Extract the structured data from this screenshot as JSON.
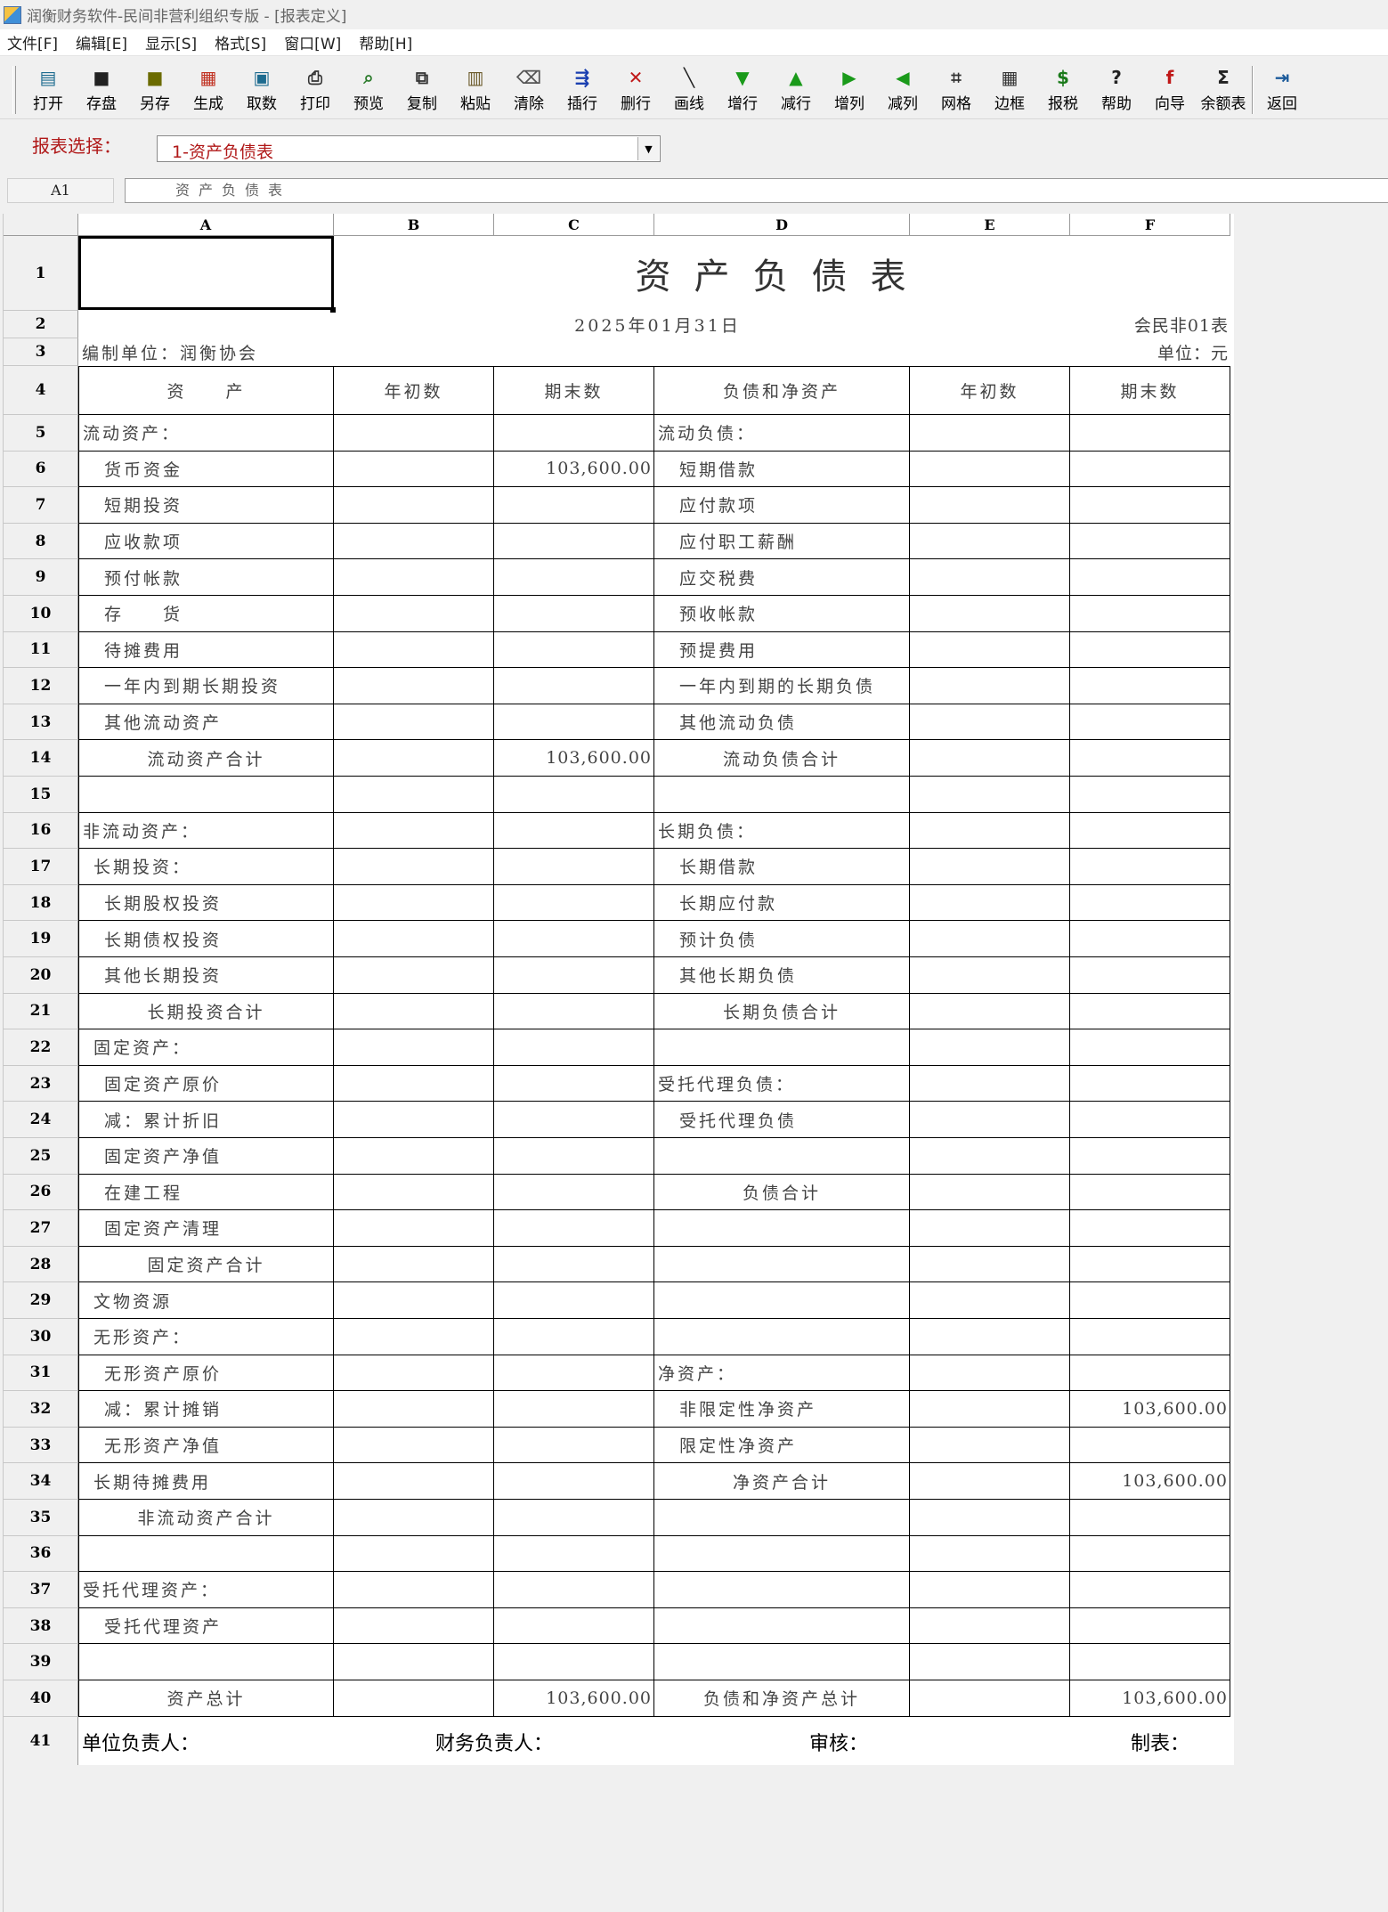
{
  "window": {
    "title": "润衡财务软件-民间非营利组织专版 - [报表定义]"
  },
  "menu": [
    "文件[F]",
    "编辑[E]",
    "显示[S]",
    "格式[S]",
    "窗口[W]",
    "帮助[H]"
  ],
  "toolbar": [
    {
      "label": "打开",
      "icon": "open-icon",
      "glyph": "▤",
      "color": "#1d6b8f"
    },
    {
      "label": "存盘",
      "icon": "save-icon",
      "glyph": "■",
      "color": "#222222"
    },
    {
      "label": "另存",
      "icon": "save-as-icon",
      "glyph": "■",
      "color": "#6b6b00"
    },
    {
      "label": "生成",
      "icon": "generate-icon",
      "glyph": "▦",
      "color": "#c03020"
    },
    {
      "label": "取数",
      "icon": "fetch-data-icon",
      "glyph": "▣",
      "color": "#1d6b8f"
    },
    {
      "label": "打印",
      "icon": "print-icon",
      "glyph": "⎙",
      "color": "#333333"
    },
    {
      "label": "预览",
      "icon": "preview-icon",
      "glyph": "⌕",
      "color": "#2a7a2a"
    },
    {
      "label": "复制",
      "icon": "copy-icon",
      "glyph": "⧉",
      "color": "#333333"
    },
    {
      "label": "粘贴",
      "icon": "paste-icon",
      "glyph": "▥",
      "color": "#6b5a2a"
    },
    {
      "label": "清除",
      "icon": "clear-icon",
      "glyph": "⌫",
      "color": "#555555"
    },
    {
      "label": "插行",
      "icon": "insert-row-icon",
      "glyph": "⇶",
      "color": "#1a3fb0"
    },
    {
      "label": "删行",
      "icon": "delete-row-icon",
      "glyph": "✕",
      "color": "#c01818"
    },
    {
      "label": "画线",
      "icon": "draw-line-icon",
      "glyph": "╲",
      "color": "#222222"
    },
    {
      "label": "增行",
      "icon": "add-row-icon",
      "glyph": "▼",
      "color": "#1a9a1a"
    },
    {
      "label": "减行",
      "icon": "remove-row-icon",
      "glyph": "▲",
      "color": "#1a9a1a"
    },
    {
      "label": "增列",
      "icon": "add-column-icon",
      "glyph": "▶",
      "color": "#1a9a1a"
    },
    {
      "label": "减列",
      "icon": "remove-column-icon",
      "glyph": "◀",
      "color": "#1a9a1a"
    },
    {
      "label": "网格",
      "icon": "grid-icon",
      "glyph": "⌗",
      "color": "#333333"
    },
    {
      "label": "边框",
      "icon": "border-icon",
      "glyph": "▦",
      "color": "#333333"
    },
    {
      "label": "报税",
      "icon": "tax-icon",
      "glyph": "$",
      "color": "#1a7a1a"
    },
    {
      "label": "帮助",
      "icon": "help-icon",
      "glyph": "?",
      "color": "#222222"
    },
    {
      "label": "向导",
      "icon": "wizard-icon",
      "glyph": "f",
      "color": "#c01818"
    },
    {
      "label": "余额表",
      "icon": "balance-table-icon",
      "glyph": "Σ",
      "color": "#222222"
    },
    {
      "label": "返回",
      "icon": "return-icon",
      "glyph": "⇥",
      "color": "#1a5a9a"
    }
  ],
  "report_select": {
    "label": "报表选择：",
    "value": "1-资产负债表"
  },
  "formula_bar": {
    "cell_ref": "A1",
    "content": "资产负债表"
  },
  "columns": [
    "A",
    "B",
    "C",
    "D",
    "E",
    "F"
  ],
  "sheet": {
    "title": "资产负债表",
    "date": "2025年01月31日",
    "form_no": "会民非01表",
    "org": "编制单位：润衡协会",
    "unit": "单位：元",
    "headers": [
      "资　　产",
      "年初数",
      "期末数",
      "负债和净资产",
      "年初数",
      "期末数"
    ],
    "rows": [
      {
        "n": "5",
        "a": "流动资产：",
        "ai": 0,
        "b": "",
        "c": "",
        "d": "流动负债：",
        "di": 0,
        "e": "",
        "f": ""
      },
      {
        "n": "6",
        "a": "货币资金",
        "ai": 2,
        "b": "",
        "c": "103,600.00",
        "d": "短期借款",
        "di": 2,
        "e": "",
        "f": ""
      },
      {
        "n": "7",
        "a": "短期投资",
        "ai": 2,
        "b": "",
        "c": "",
        "d": "应付款项",
        "di": 2,
        "e": "",
        "f": ""
      },
      {
        "n": "8",
        "a": "应收款项",
        "ai": 2,
        "b": "",
        "c": "",
        "d": "应付职工薪酬",
        "di": 2,
        "e": "",
        "f": ""
      },
      {
        "n": "9",
        "a": "预付帐款",
        "ai": 2,
        "b": "",
        "c": "",
        "d": "应交税费",
        "di": 2,
        "e": "",
        "f": ""
      },
      {
        "n": "10",
        "a": "存　　货",
        "ai": 2,
        "b": "",
        "c": "",
        "d": "预收帐款",
        "di": 2,
        "e": "",
        "f": ""
      },
      {
        "n": "11",
        "a": "待摊费用",
        "ai": 2,
        "b": "",
        "c": "",
        "d": "预提费用",
        "di": 2,
        "e": "",
        "f": ""
      },
      {
        "n": "12",
        "a": "一年内到期长期投资",
        "ai": 2,
        "b": "",
        "c": "",
        "d": "一年内到期的长期负债",
        "di": 2,
        "e": "",
        "f": ""
      },
      {
        "n": "13",
        "a": "其他流动资产",
        "ai": 2,
        "b": "",
        "c": "",
        "d": "其他流动负债",
        "di": 2,
        "e": "",
        "f": ""
      },
      {
        "n": "14",
        "a": "流动资产合计",
        "ai": -1,
        "b": "",
        "c": "103,600.00",
        "d": "流动负债合计",
        "di": -1,
        "e": "",
        "f": ""
      },
      {
        "n": "15",
        "a": "",
        "ai": 0,
        "b": "",
        "c": "",
        "d": "",
        "di": 0,
        "e": "",
        "f": ""
      },
      {
        "n": "16",
        "a": "非流动资产：",
        "ai": 0,
        "b": "",
        "c": "",
        "d": "长期负债：",
        "di": 0,
        "e": "",
        "f": ""
      },
      {
        "n": "17",
        "a": "长期投资：",
        "ai": 1,
        "b": "",
        "c": "",
        "d": "长期借款",
        "di": 2,
        "e": "",
        "f": ""
      },
      {
        "n": "18",
        "a": "长期股权投资",
        "ai": 2,
        "b": "",
        "c": "",
        "d": "长期应付款",
        "di": 2,
        "e": "",
        "f": ""
      },
      {
        "n": "19",
        "a": "长期债权投资",
        "ai": 2,
        "b": "",
        "c": "",
        "d": "预计负债",
        "di": 2,
        "e": "",
        "f": ""
      },
      {
        "n": "20",
        "a": "其他长期投资",
        "ai": 2,
        "b": "",
        "c": "",
        "d": "其他长期负债",
        "di": 2,
        "e": "",
        "f": ""
      },
      {
        "n": "21",
        "a": "长期投资合计",
        "ai": -1,
        "b": "",
        "c": "",
        "d": "长期负债合计",
        "di": -1,
        "e": "",
        "f": ""
      },
      {
        "n": "22",
        "a": "固定资产：",
        "ai": 1,
        "b": "",
        "c": "",
        "d": "",
        "di": 0,
        "e": "",
        "f": ""
      },
      {
        "n": "23",
        "a": "固定资产原价",
        "ai": 2,
        "b": "",
        "c": "",
        "d": "受托代理负债：",
        "di": 0,
        "e": "",
        "f": ""
      },
      {
        "n": "24",
        "a": "减：累计折旧",
        "ai": 2,
        "b": "",
        "c": "",
        "d": "受托代理负债",
        "di": 2,
        "e": "",
        "f": ""
      },
      {
        "n": "25",
        "a": "固定资产净值",
        "ai": 2,
        "b": "",
        "c": "",
        "d": "",
        "di": 0,
        "e": "",
        "f": ""
      },
      {
        "n": "26",
        "a": "在建工程",
        "ai": 2,
        "b": "",
        "c": "",
        "d": "负债合计",
        "di": -1,
        "e": "",
        "f": ""
      },
      {
        "n": "27",
        "a": "固定资产清理",
        "ai": 2,
        "b": "",
        "c": "",
        "d": "",
        "di": 0,
        "e": "",
        "f": ""
      },
      {
        "n": "28",
        "a": "固定资产合计",
        "ai": -1,
        "b": "",
        "c": "",
        "d": "",
        "di": 0,
        "e": "",
        "f": ""
      },
      {
        "n": "29",
        "a": "文物资源",
        "ai": 1,
        "b": "",
        "c": "",
        "d": "",
        "di": 0,
        "e": "",
        "f": ""
      },
      {
        "n": "30",
        "a": "无形资产：",
        "ai": 1,
        "b": "",
        "c": "",
        "d": "",
        "di": 0,
        "e": "",
        "f": ""
      },
      {
        "n": "31",
        "a": "无形资产原价",
        "ai": 2,
        "b": "",
        "c": "",
        "d": "净资产：",
        "di": 0,
        "e": "",
        "f": ""
      },
      {
        "n": "32",
        "a": "减：累计摊销",
        "ai": 2,
        "b": "",
        "c": "",
        "d": "非限定性净资产",
        "di": 2,
        "e": "",
        "f": "103,600.00"
      },
      {
        "n": "33",
        "a": "无形资产净值",
        "ai": 2,
        "b": "",
        "c": "",
        "d": "限定性净资产",
        "di": 2,
        "e": "",
        "f": ""
      },
      {
        "n": "34",
        "a": "长期待摊费用",
        "ai": 1,
        "b": "",
        "c": "",
        "d": "净资产合计",
        "di": -1,
        "e": "",
        "f": "103,600.00"
      },
      {
        "n": "35",
        "a": "非流动资产合计",
        "ai": -1,
        "b": "",
        "c": "",
        "d": "",
        "di": 0,
        "e": "",
        "f": ""
      },
      {
        "n": "36",
        "a": "",
        "ai": 0,
        "b": "",
        "c": "",
        "d": "",
        "di": 0,
        "e": "",
        "f": ""
      },
      {
        "n": "37",
        "a": "受托代理资产：",
        "ai": 0,
        "b": "",
        "c": "",
        "d": "",
        "di": 0,
        "e": "",
        "f": ""
      },
      {
        "n": "38",
        "a": "受托代理资产",
        "ai": 2,
        "b": "",
        "c": "",
        "d": "",
        "di": 0,
        "e": "",
        "f": ""
      },
      {
        "n": "39",
        "a": "",
        "ai": 0,
        "b": "",
        "c": "",
        "d": "",
        "di": 0,
        "e": "",
        "f": ""
      },
      {
        "n": "40",
        "a": "资产总计",
        "ai": -1,
        "b": "",
        "c": "103,600.00",
        "d": "负债和净资产总计",
        "di": -1,
        "e": "",
        "f": "103,600.00"
      }
    ],
    "signatures": [
      "单位负责人：",
      "财务负责人：",
      "审核：",
      "制表："
    ]
  }
}
